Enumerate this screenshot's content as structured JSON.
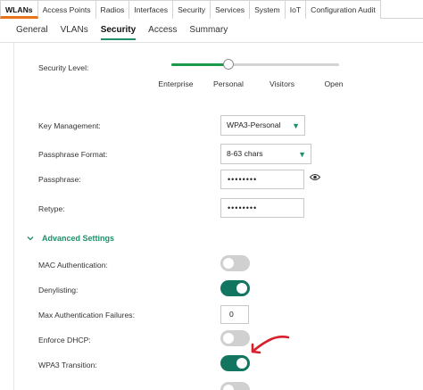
{
  "top_tabs": [
    "WLANs",
    "Access Points",
    "Radios",
    "Interfaces",
    "Security",
    "Services",
    "System",
    "IoT",
    "Configuration Audit"
  ],
  "top_active": "WLANs",
  "sub_tabs": [
    "General",
    "VLANs",
    "Security",
    "Access",
    "Summary"
  ],
  "sub_active": "Security",
  "security_level": {
    "label": "Security Level:",
    "stops": [
      "Enterprise",
      "Personal",
      "Visitors",
      "Open"
    ],
    "selected": "Personal",
    "accent": "#1a9a4a"
  },
  "key_management": {
    "label": "Key Management:",
    "value": "WPA3-Personal"
  },
  "passphrase_format": {
    "label": "Passphrase Format:",
    "value": "8-63 chars"
  },
  "passphrase": {
    "label": "Passphrase:",
    "value": "••••••••",
    "reveal_icon": "eye-icon"
  },
  "retype": {
    "label": "Retype:",
    "value": "••••••••"
  },
  "advanced": {
    "title": "Advanced Settings",
    "expanded": true,
    "toggle_on_color": "#127560",
    "mac_auth": {
      "label": "MAC Authentication:",
      "on": false
    },
    "denylisting": {
      "label": "Denylisting:",
      "on": true
    },
    "max_auth_failures": {
      "label": "Max Authentication Failures:",
      "value": "0"
    },
    "enforce_dhcp": {
      "label": "Enforce DHCP:",
      "on": false
    },
    "wpa3_transition": {
      "label": "WPA3 Transition:",
      "on": true
    },
    "next_toggle_on": false
  },
  "annotation_color": "#d9202a",
  "tab_accent": "#e8731a"
}
